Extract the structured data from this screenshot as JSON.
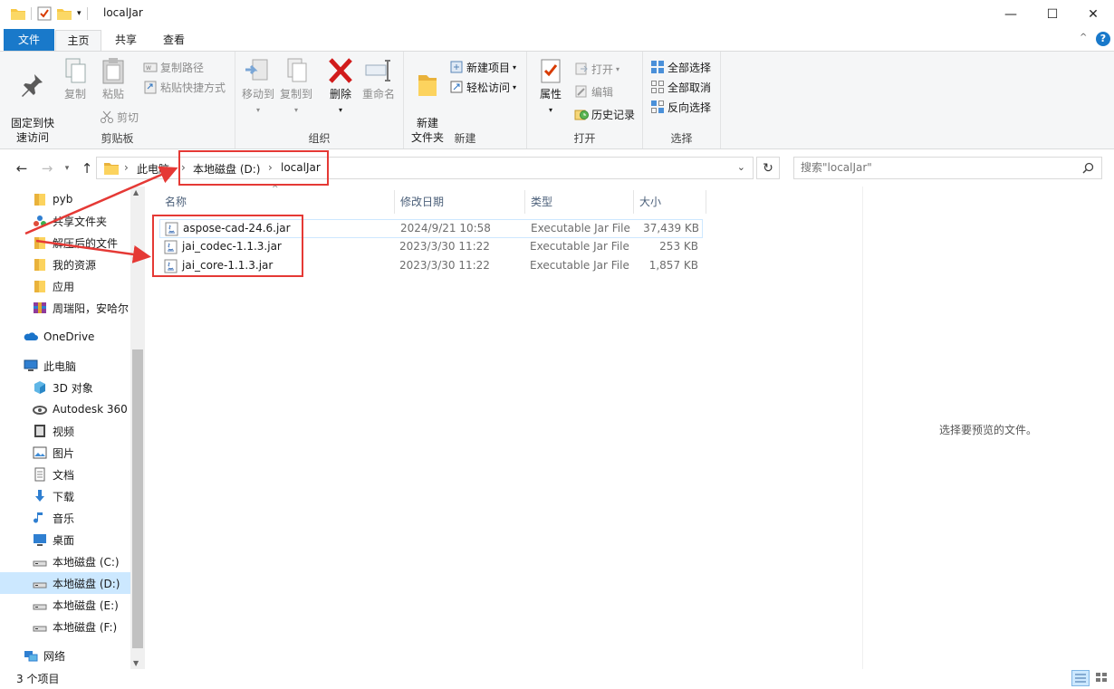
{
  "window": {
    "title": "localJar",
    "minimize_glyph": "—",
    "maximize_glyph": "☐",
    "close_glyph": "✕"
  },
  "ribbon_tabs": {
    "file": "文件",
    "home": "主页",
    "share": "共享",
    "view": "查看"
  },
  "ribbon": {
    "clipboard": {
      "label": "剪贴板",
      "pin": "固定到快\n速访问",
      "copy": "复制",
      "paste": "粘贴",
      "copy_path": "复制路径",
      "paste_shortcut": "粘贴快捷方式",
      "cut": "剪切"
    },
    "organize": {
      "label": "组织",
      "move_to": "移动到",
      "copy_to": "复制到",
      "delete": "删除",
      "rename": "重命名"
    },
    "new": {
      "label": "新建",
      "new_folder": "新建\n文件夹",
      "new_item": "新建项目",
      "easy_access": "轻松访问"
    },
    "open": {
      "label": "打开",
      "properties": "属性",
      "open": "打开",
      "edit": "编辑",
      "history": "历史记录"
    },
    "select": {
      "label": "选择",
      "select_all": "全部选择",
      "select_none": "全部取消",
      "invert": "反向选择"
    }
  },
  "address": {
    "segments": [
      "此电脑",
      "本地磁盘 (D:)",
      "localJar"
    ],
    "separator": "›"
  },
  "search": {
    "placeholder": "搜索\"localJar\""
  },
  "sidebar": {
    "items": [
      {
        "label": "pyb",
        "icon": "folder-icon"
      },
      {
        "label": "共享文件夹",
        "icon": "shared-folder-icon"
      },
      {
        "label": "解压后的文件",
        "icon": "folder-icon"
      },
      {
        "label": "我的资源",
        "icon": "folder-icon"
      },
      {
        "label": "应用",
        "icon": "folder-icon"
      },
      {
        "label": "周瑞阳，安哈尔",
        "icon": "archive-icon"
      },
      {
        "label": "OneDrive",
        "icon": "cloud-icon"
      },
      {
        "label": "此电脑",
        "icon": "computer-icon"
      },
      {
        "label": "3D 对象",
        "icon": "cube-icon"
      },
      {
        "label": "Autodesk 360",
        "icon": "autodesk-icon"
      },
      {
        "label": "视频",
        "icon": "video-icon"
      },
      {
        "label": "图片",
        "icon": "picture-icon"
      },
      {
        "label": "文档",
        "icon": "document-icon"
      },
      {
        "label": "下载",
        "icon": "download-icon"
      },
      {
        "label": "音乐",
        "icon": "music-icon"
      },
      {
        "label": "桌面",
        "icon": "desktop-icon"
      },
      {
        "label": "本地磁盘 (C:)",
        "icon": "drive-icon"
      },
      {
        "label": "本地磁盘 (D:)",
        "icon": "drive-icon",
        "selected": true
      },
      {
        "label": "本地磁盘 (E:)",
        "icon": "drive-icon"
      },
      {
        "label": "本地磁盘 (F:)",
        "icon": "drive-icon"
      },
      {
        "label": "网络",
        "icon": "network-icon"
      }
    ]
  },
  "columns": {
    "name": "名称",
    "modified": "修改日期",
    "type": "类型",
    "size": "大小"
  },
  "files": [
    {
      "name": "aspose-cad-24.6.jar",
      "modified": "2024/9/21 10:58",
      "type": "Executable Jar File",
      "size": "37,439 KB"
    },
    {
      "name": "jai_codec-1.1.3.jar",
      "modified": "2023/3/30 11:22",
      "type": "Executable Jar File",
      "size": "253 KB"
    },
    {
      "name": "jai_core-1.1.3.jar",
      "modified": "2023/3/30 11:22",
      "type": "Executable Jar File",
      "size": "1,857 KB"
    }
  ],
  "preview": {
    "message": "选择要预览的文件。"
  },
  "status": {
    "count": "3 个项目"
  },
  "colors": {
    "accent": "#1979ca",
    "selection": "#cce8ff",
    "annotation": "#e53935"
  }
}
